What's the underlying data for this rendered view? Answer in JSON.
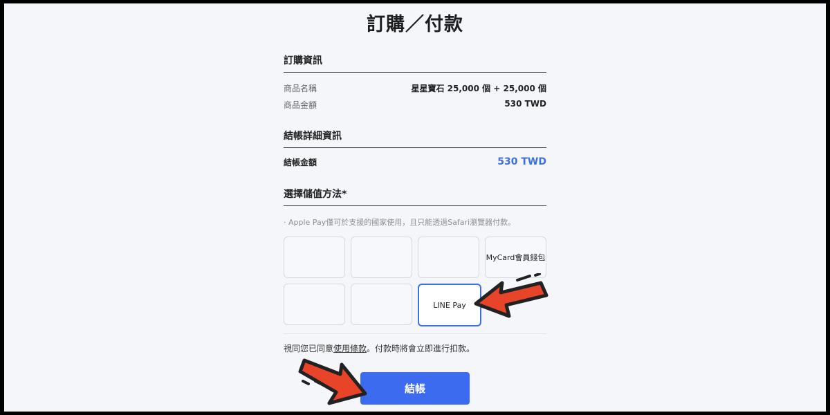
{
  "page": {
    "title": "訂購／付款"
  },
  "order_info": {
    "heading": "訂購資訊",
    "rows": [
      {
        "label": "商品名稱",
        "value": "星星寶石 25,000 個 + 25,000 個"
      },
      {
        "label": "商品金額",
        "value": "530 TWD"
      }
    ]
  },
  "checkout_details": {
    "heading": "結帳詳細資訊",
    "total_label": "結帳金額",
    "total_value": "530 TWD"
  },
  "payment": {
    "heading": "選擇儲值方法*",
    "note": "· Apple Pay僅可於支援的國家使用，且只能透過Safari瀏覽器付款。",
    "options": [
      {
        "label": ""
      },
      {
        "label": ""
      },
      {
        "label": ""
      },
      {
        "label": "MyCard會員錢包"
      },
      {
        "label": ""
      },
      {
        "label": ""
      },
      {
        "label": "LINE Pay",
        "selected": true
      }
    ]
  },
  "agreement": {
    "prefix": "視同您已同意",
    "link": "使用條款",
    "suffix": "。付款時將會立即進行扣款。"
  },
  "checkout_button": {
    "label": "結帳"
  },
  "colors": {
    "accent": "#3d6fe6",
    "button": "#3c6bf0",
    "arrow_fill": "#e8442a",
    "arrow_outline": "#222222"
  }
}
